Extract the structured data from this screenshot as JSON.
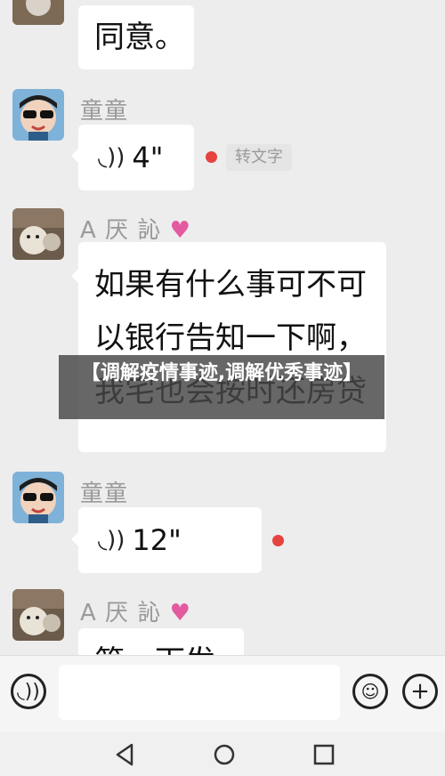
{
  "top_message": {
    "text": "同意。"
  },
  "messages": [
    {
      "sender": "童童",
      "type": "voice",
      "duration": "4\"",
      "transcribe_label": "转文字"
    },
    {
      "sender": "A 厌 訫",
      "type": "text",
      "text": "如果有什么事可不可以银行告知一下啊，我宅也会按时还房贷"
    },
    {
      "sender": "童童",
      "type": "voice",
      "duration": "12\""
    },
    {
      "sender": "A 厌 訫",
      "type": "text",
      "text": "第一下发"
    }
  ],
  "overlay": {
    "title": "【调解疫情事迹,调解优秀事迹】"
  },
  "icons": {
    "voice_toggle": "voice-icon",
    "emoji": "emoji-icon",
    "plus": "plus-icon",
    "back": "back-icon",
    "home": "home-icon",
    "recents": "recents-icon"
  },
  "colors": {
    "unread_dot": "#e64340",
    "chat_bg": "#ededed",
    "bubble": "#ffffff"
  }
}
